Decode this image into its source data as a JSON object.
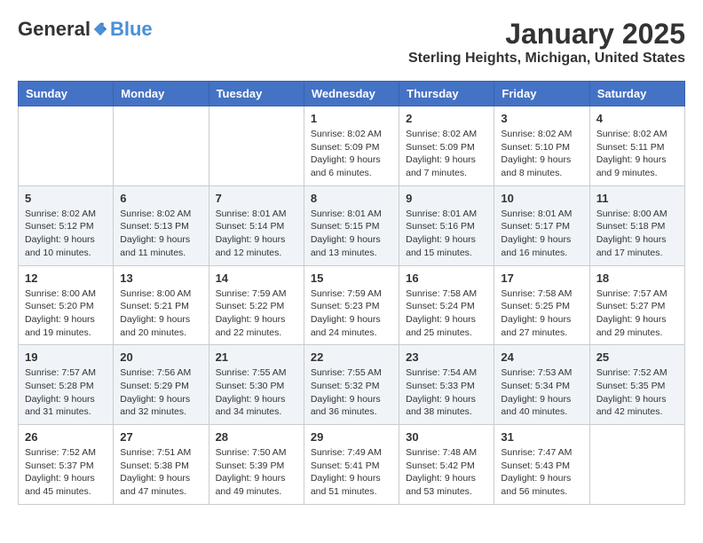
{
  "header": {
    "logo_general": "General",
    "logo_blue": "Blue",
    "month": "January 2025",
    "location": "Sterling Heights, Michigan, United States"
  },
  "days_of_week": [
    "Sunday",
    "Monday",
    "Tuesday",
    "Wednesday",
    "Thursday",
    "Friday",
    "Saturday"
  ],
  "weeks": [
    [
      {
        "day": "",
        "info": ""
      },
      {
        "day": "",
        "info": ""
      },
      {
        "day": "",
        "info": ""
      },
      {
        "day": "1",
        "info": "Sunrise: 8:02 AM\nSunset: 5:09 PM\nDaylight: 9 hours and 6 minutes."
      },
      {
        "day": "2",
        "info": "Sunrise: 8:02 AM\nSunset: 5:09 PM\nDaylight: 9 hours and 7 minutes."
      },
      {
        "day": "3",
        "info": "Sunrise: 8:02 AM\nSunset: 5:10 PM\nDaylight: 9 hours and 8 minutes."
      },
      {
        "day": "4",
        "info": "Sunrise: 8:02 AM\nSunset: 5:11 PM\nDaylight: 9 hours and 9 minutes."
      }
    ],
    [
      {
        "day": "5",
        "info": "Sunrise: 8:02 AM\nSunset: 5:12 PM\nDaylight: 9 hours and 10 minutes."
      },
      {
        "day": "6",
        "info": "Sunrise: 8:02 AM\nSunset: 5:13 PM\nDaylight: 9 hours and 11 minutes."
      },
      {
        "day": "7",
        "info": "Sunrise: 8:01 AM\nSunset: 5:14 PM\nDaylight: 9 hours and 12 minutes."
      },
      {
        "day": "8",
        "info": "Sunrise: 8:01 AM\nSunset: 5:15 PM\nDaylight: 9 hours and 13 minutes."
      },
      {
        "day": "9",
        "info": "Sunrise: 8:01 AM\nSunset: 5:16 PM\nDaylight: 9 hours and 15 minutes."
      },
      {
        "day": "10",
        "info": "Sunrise: 8:01 AM\nSunset: 5:17 PM\nDaylight: 9 hours and 16 minutes."
      },
      {
        "day": "11",
        "info": "Sunrise: 8:00 AM\nSunset: 5:18 PM\nDaylight: 9 hours and 17 minutes."
      }
    ],
    [
      {
        "day": "12",
        "info": "Sunrise: 8:00 AM\nSunset: 5:20 PM\nDaylight: 9 hours and 19 minutes."
      },
      {
        "day": "13",
        "info": "Sunrise: 8:00 AM\nSunset: 5:21 PM\nDaylight: 9 hours and 20 minutes."
      },
      {
        "day": "14",
        "info": "Sunrise: 7:59 AM\nSunset: 5:22 PM\nDaylight: 9 hours and 22 minutes."
      },
      {
        "day": "15",
        "info": "Sunrise: 7:59 AM\nSunset: 5:23 PM\nDaylight: 9 hours and 24 minutes."
      },
      {
        "day": "16",
        "info": "Sunrise: 7:58 AM\nSunset: 5:24 PM\nDaylight: 9 hours and 25 minutes."
      },
      {
        "day": "17",
        "info": "Sunrise: 7:58 AM\nSunset: 5:25 PM\nDaylight: 9 hours and 27 minutes."
      },
      {
        "day": "18",
        "info": "Sunrise: 7:57 AM\nSunset: 5:27 PM\nDaylight: 9 hours and 29 minutes."
      }
    ],
    [
      {
        "day": "19",
        "info": "Sunrise: 7:57 AM\nSunset: 5:28 PM\nDaylight: 9 hours and 31 minutes."
      },
      {
        "day": "20",
        "info": "Sunrise: 7:56 AM\nSunset: 5:29 PM\nDaylight: 9 hours and 32 minutes."
      },
      {
        "day": "21",
        "info": "Sunrise: 7:55 AM\nSunset: 5:30 PM\nDaylight: 9 hours and 34 minutes."
      },
      {
        "day": "22",
        "info": "Sunrise: 7:55 AM\nSunset: 5:32 PM\nDaylight: 9 hours and 36 minutes."
      },
      {
        "day": "23",
        "info": "Sunrise: 7:54 AM\nSunset: 5:33 PM\nDaylight: 9 hours and 38 minutes."
      },
      {
        "day": "24",
        "info": "Sunrise: 7:53 AM\nSunset: 5:34 PM\nDaylight: 9 hours and 40 minutes."
      },
      {
        "day": "25",
        "info": "Sunrise: 7:52 AM\nSunset: 5:35 PM\nDaylight: 9 hours and 42 minutes."
      }
    ],
    [
      {
        "day": "26",
        "info": "Sunrise: 7:52 AM\nSunset: 5:37 PM\nDaylight: 9 hours and 45 minutes."
      },
      {
        "day": "27",
        "info": "Sunrise: 7:51 AM\nSunset: 5:38 PM\nDaylight: 9 hours and 47 minutes."
      },
      {
        "day": "28",
        "info": "Sunrise: 7:50 AM\nSunset: 5:39 PM\nDaylight: 9 hours and 49 minutes."
      },
      {
        "day": "29",
        "info": "Sunrise: 7:49 AM\nSunset: 5:41 PM\nDaylight: 9 hours and 51 minutes."
      },
      {
        "day": "30",
        "info": "Sunrise: 7:48 AM\nSunset: 5:42 PM\nDaylight: 9 hours and 53 minutes."
      },
      {
        "day": "31",
        "info": "Sunrise: 7:47 AM\nSunset: 5:43 PM\nDaylight: 9 hours and 56 minutes."
      },
      {
        "day": "",
        "info": ""
      }
    ]
  ]
}
